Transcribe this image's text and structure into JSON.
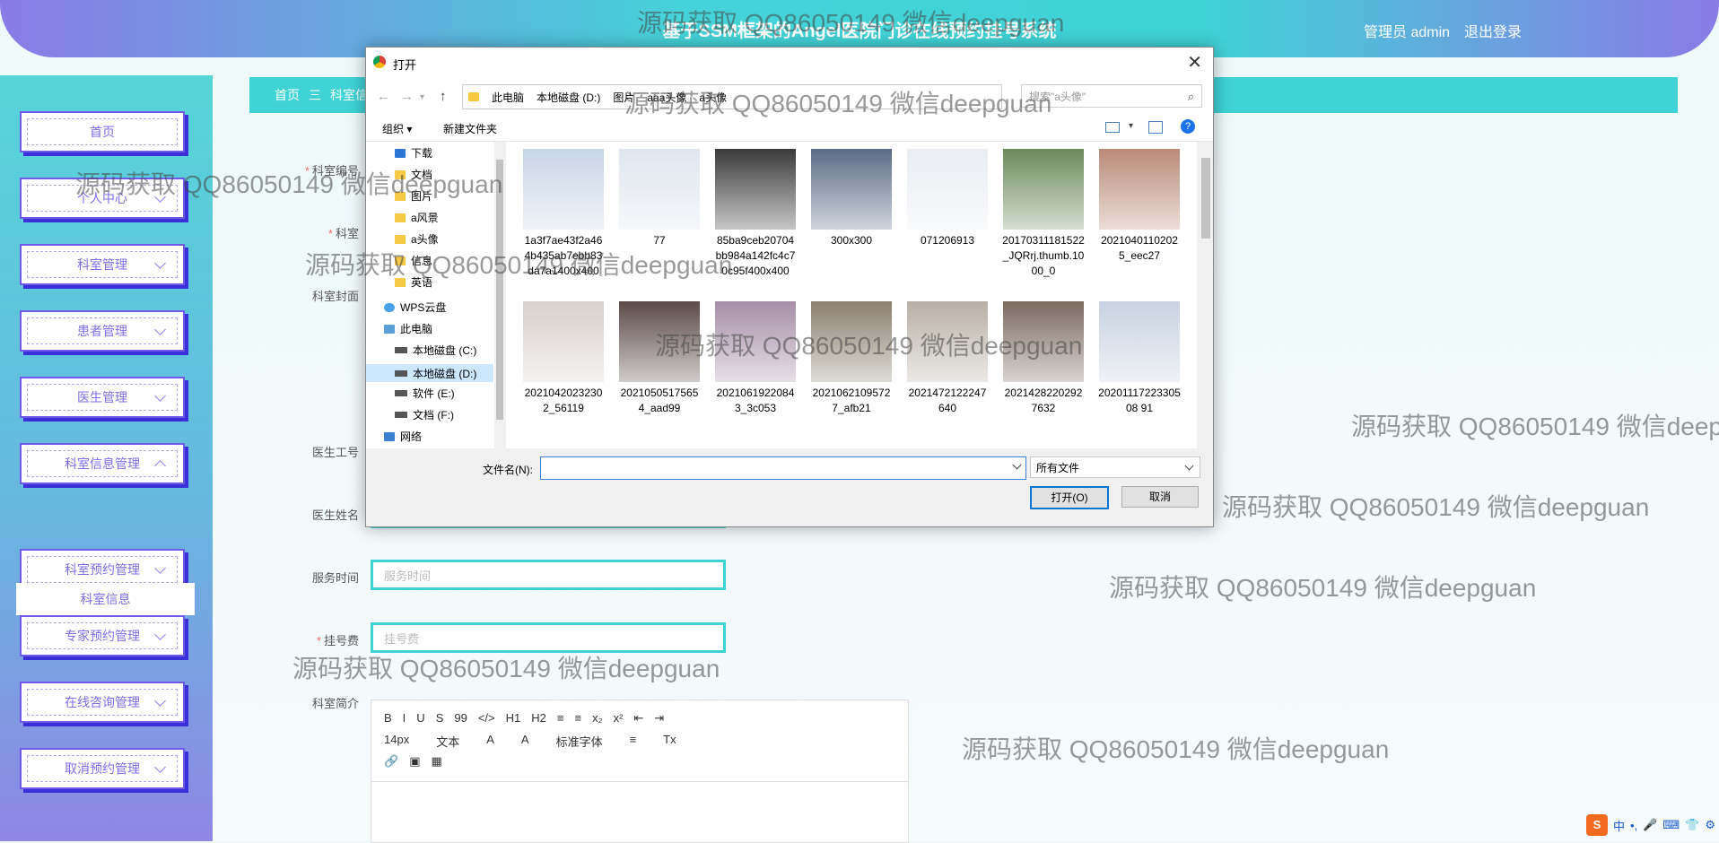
{
  "header": {
    "title": "基于SSM框架的Angel医院门诊在线预约挂号系统",
    "user_label": "管理员 admin",
    "logout_label": "退出登录"
  },
  "sidebar": {
    "items": [
      {
        "label": "首页"
      },
      {
        "label": "个人中心"
      },
      {
        "label": "科室管理"
      },
      {
        "label": "患者管理"
      },
      {
        "label": "医生管理"
      },
      {
        "label": "科室信息管理"
      },
      {
        "label": "科室预约管理"
      },
      {
        "label": "专家预约管理"
      },
      {
        "label": "在线咨询管理"
      },
      {
        "label": "取消预约管理"
      }
    ],
    "sub_item": "科室信息"
  },
  "breadcrumb": {
    "home": "首页",
    "sep": "三",
    "current": "科室信息"
  },
  "form": {
    "fields": [
      {
        "label": "科室编号",
        "required": true
      },
      {
        "label": "科室",
        "required": true
      },
      {
        "label": "科室封面",
        "required": false
      },
      {
        "label": "医生工号",
        "required": false
      },
      {
        "label": "医生姓名",
        "required": false
      },
      {
        "label": "服务时间",
        "required": false,
        "placeholder": "服务时间"
      },
      {
        "label": "挂号费",
        "required": true,
        "placeholder": "挂号费"
      },
      {
        "label": "科室简介",
        "required": false
      }
    ],
    "editor": {
      "row1": [
        "B",
        "I",
        "U",
        "S",
        "99",
        "</>",
        "H1",
        "H2",
        "≡",
        "≡",
        "x₂",
        "x²",
        "⇤",
        "⇥"
      ],
      "row2": [
        "14px",
        "文本",
        "A",
        "A",
        "标准字体",
        "≡",
        "Tx"
      ],
      "row3": [
        "🔗",
        "▣",
        "▦"
      ]
    }
  },
  "dialog": {
    "title": "打开",
    "path": [
      "此电脑",
      "本地磁盘 (D:)",
      "图片",
      "aaa头像",
      "a头像"
    ],
    "search_placeholder": "搜索\"a头像\"",
    "organize": "组织 ▾",
    "new_folder": "新建文件夹",
    "tree": [
      {
        "label": "下载",
        "type": "down"
      },
      {
        "label": "文档",
        "type": "folder"
      },
      {
        "label": "图片",
        "type": "folder"
      },
      {
        "label": "a风景",
        "type": "folder"
      },
      {
        "label": "a头像",
        "type": "folder"
      },
      {
        "label": "信息",
        "type": "folder"
      },
      {
        "label": "英语",
        "type": "folder"
      },
      {
        "label": "WPS云盘",
        "type": "cloud"
      },
      {
        "label": "此电脑",
        "type": "pc"
      },
      {
        "label": "本地磁盘 (C:)",
        "type": "drive"
      },
      {
        "label": "本地磁盘 (D:)",
        "type": "drive",
        "selected": true
      },
      {
        "label": "软件 (E:)",
        "type": "drive"
      },
      {
        "label": "文档 (F:)",
        "type": "drive"
      },
      {
        "label": "网络",
        "type": "net"
      }
    ],
    "files": [
      {
        "name": "1a3f7ae43f2a464b435ab7ebb83da7a1400x400",
        "color": "#c9d6e6"
      },
      {
        "name": "77",
        "color": "#dfe6ee"
      },
      {
        "name": "85ba9ceb20704bb984a142fc4c70c95f400x400",
        "color": "#3a3a3a"
      },
      {
        "name": "300x300",
        "color": "#5c6b85"
      },
      {
        "name": "071206913",
        "color": "#e9edf2"
      },
      {
        "name": "20170311181522_JQRrj.thumb.1000_0",
        "color": "#6b8a5a"
      },
      {
        "name": "20210401102025_eec27",
        "color": "#b98a78"
      },
      {
        "name": "20210420232302_56119",
        "color": "#d8d0cc"
      },
      {
        "name": "20210505175654_aad99",
        "color": "#5a4a48"
      },
      {
        "name": "20210619220843_3c053",
        "color": "#a58fa6"
      },
      {
        "name": "20210621095727_afb21",
        "color": "#8a8070"
      },
      {
        "name": "2021472122247640",
        "color": "#b8b0a6"
      },
      {
        "name": "20214282202927632",
        "color": "#7a6a60"
      },
      {
        "name": "2020111722330508 91",
        "color": "#c8d2e0"
      },
      {
        "name": "",
        "color": "#9a8a80"
      },
      {
        "name": "",
        "color": "#6a5a50"
      },
      {
        "name": "",
        "color": "#a0908a"
      },
      {
        "name": "",
        "color": "#3a3030"
      },
      {
        "name": "",
        "color": "#d6cdc6"
      },
      {
        "name": "",
        "color": "#8a7a72"
      },
      {
        "name": "",
        "color": "#b0a098"
      }
    ],
    "filename_label": "文件名(N):",
    "filter": "所有文件",
    "open_label": "打开(O)",
    "cancel_label": "取消"
  },
  "watermark": "源码获取 QQ86050149 微信deepguan",
  "ime": {
    "lang": "中",
    "items": [
      "•,",
      "🎤",
      "⌨",
      "👕",
      "⚙"
    ]
  },
  "colors": {
    "accent": "#3fd3d6",
    "purple": "#7d6ee8",
    "dialog_bg": "#f0f0f0"
  }
}
